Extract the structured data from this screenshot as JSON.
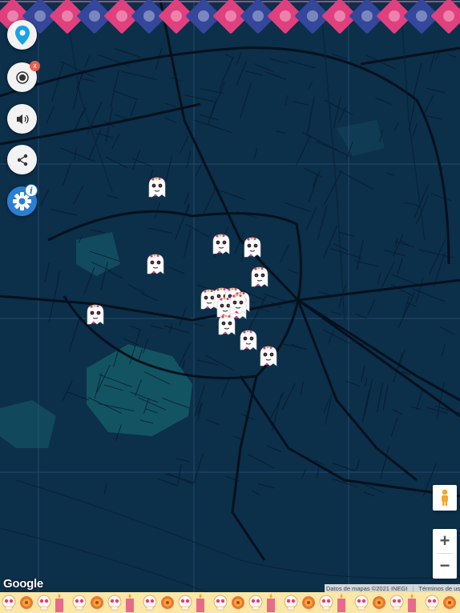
{
  "map": {
    "theme": "dark-blue",
    "background_color": "#0c2f4a",
    "road_color": "#071a29",
    "major_road_color": "#05121d"
  },
  "banner": {
    "description_colors": [
      "#e0407e",
      "#34479b"
    ]
  },
  "controls": [
    {
      "name": "location-pin-icon",
      "label": "location"
    },
    {
      "name": "record-icon",
      "label": "record",
      "badge": "x"
    },
    {
      "name": "sound-icon",
      "label": "sound"
    },
    {
      "name": "share-icon",
      "label": "share"
    },
    {
      "name": "settings-icon",
      "label": "settings",
      "badge": "i"
    }
  ],
  "markers": {
    "icon": "ghost-sugar-skull-icon",
    "count": 16
  },
  "map_controls": {
    "zoom_in": "+",
    "zoom_out": "−",
    "pegman": "street-view-pegman-icon"
  },
  "logo": "Google",
  "attribution": {
    "data": "Datos de mapas ©2021 INEGI",
    "terms": "Términos de uso"
  },
  "footer": {
    "icons": [
      "sugar-skull-icon",
      "marigold-flower-icon",
      "candle-icon"
    ]
  }
}
